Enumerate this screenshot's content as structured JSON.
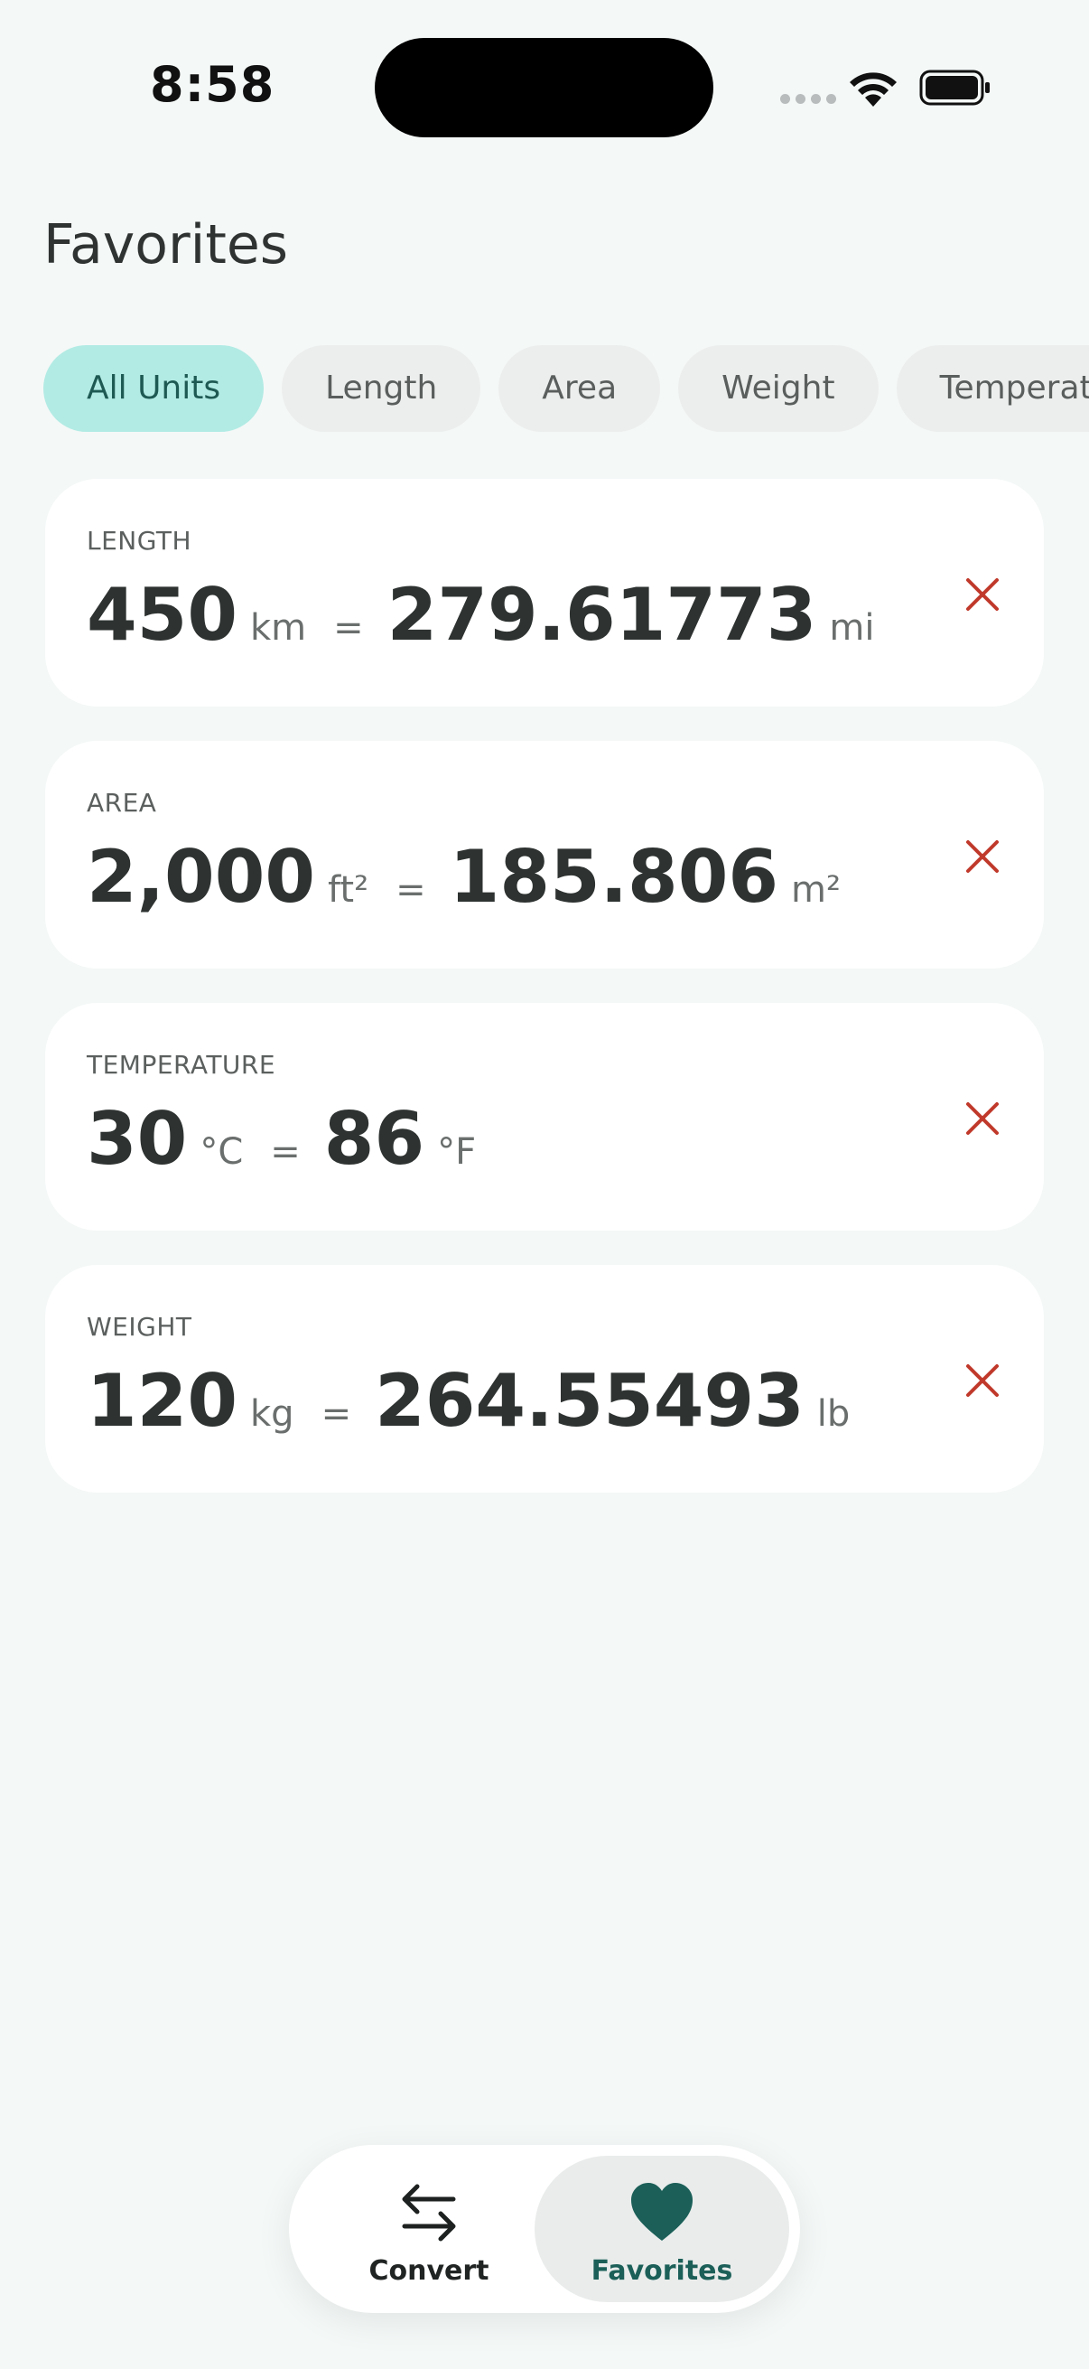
{
  "status": {
    "time": "8:58"
  },
  "header": {
    "title": "Favorites"
  },
  "filters": [
    {
      "label": "All Units",
      "active": true
    },
    {
      "label": "Length",
      "active": false
    },
    {
      "label": "Area",
      "active": false
    },
    {
      "label": "Weight",
      "active": false
    },
    {
      "label": "Temperature",
      "active": false
    }
  ],
  "favorites": [
    {
      "category": "LENGTH",
      "from_value": "450",
      "from_unit": "km",
      "equals": "=",
      "to_value": "279.61773",
      "to_unit": "mi"
    },
    {
      "category": "AREA",
      "from_value": "2,000",
      "from_unit": "ft²",
      "equals": "=",
      "to_value": "185.806",
      "to_unit": "m²"
    },
    {
      "category": "TEMPERATURE",
      "from_value": "30",
      "from_unit": "°C",
      "equals": "=",
      "to_value": "86",
      "to_unit": "°F"
    },
    {
      "category": "WEIGHT",
      "from_value": "120",
      "from_unit": "kg",
      "equals": "=",
      "to_value": "264.55493",
      "to_unit": "lb"
    }
  ],
  "tabbar": {
    "convert_label": "Convert",
    "favorites_label": "Favorites",
    "active": "favorites"
  },
  "colors": {
    "accent": "#1b5f58",
    "chip_active": "#b2ebe4",
    "remove": "#c0392b",
    "background": "#f4f8f7"
  },
  "icons": {
    "remove": "close-icon",
    "convert": "swap-arrows-icon",
    "favorites": "heart-icon"
  }
}
